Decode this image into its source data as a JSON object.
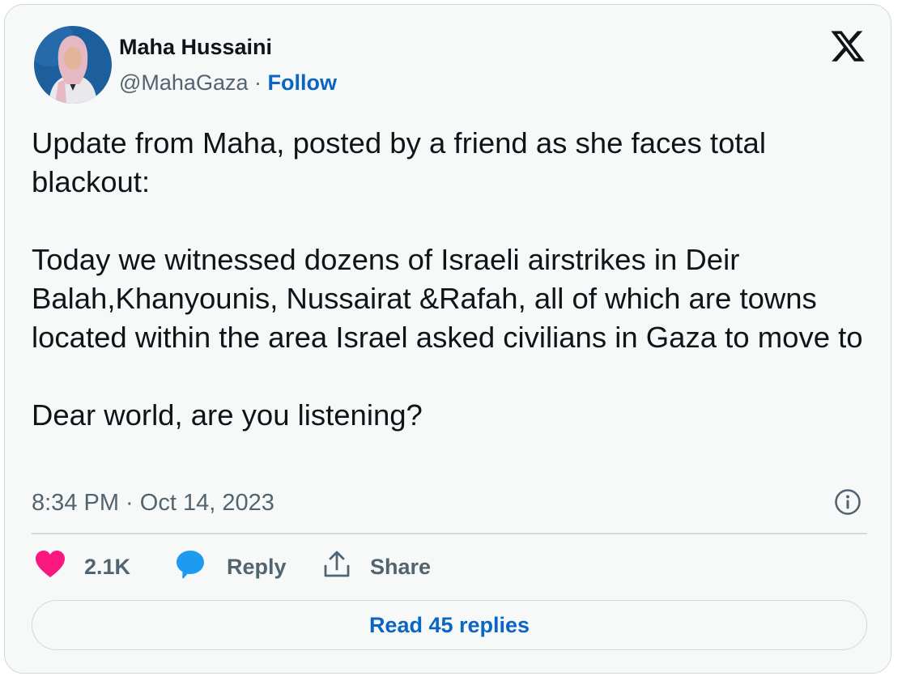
{
  "author": {
    "name": "Maha Hussaini",
    "handle": "@MahaGaza",
    "separator": "·",
    "follow_label": "Follow"
  },
  "tweet": {
    "paragraphs": [
      "Update from Maha, posted by a friend as she faces total blackout:",
      "Today we witnessed dozens of Israeli airstrikes in Deir Balah,Khanyounis, Nussairat &Rafah, all of which are towns located within the area Israel asked civilians in Gaza to move to",
      "Dear world, are you listening?"
    ],
    "timestamp": "8:34 PM · Oct 14, 2023"
  },
  "actions": {
    "like_count": "2.1K",
    "reply_label": "Reply",
    "share_label": "Share"
  },
  "read_replies_label": "Read 45 replies",
  "icons": {
    "platform": "x-logo-icon",
    "info": "info-icon",
    "like": "heart-icon",
    "reply": "speech-bubble-icon",
    "share": "share-icon"
  },
  "colors": {
    "like": "#f91880",
    "reply": "#1d9bf0",
    "link": "#0a66c2",
    "muted": "#536471",
    "text": "#0f1419",
    "background": "#f7f9f9"
  }
}
